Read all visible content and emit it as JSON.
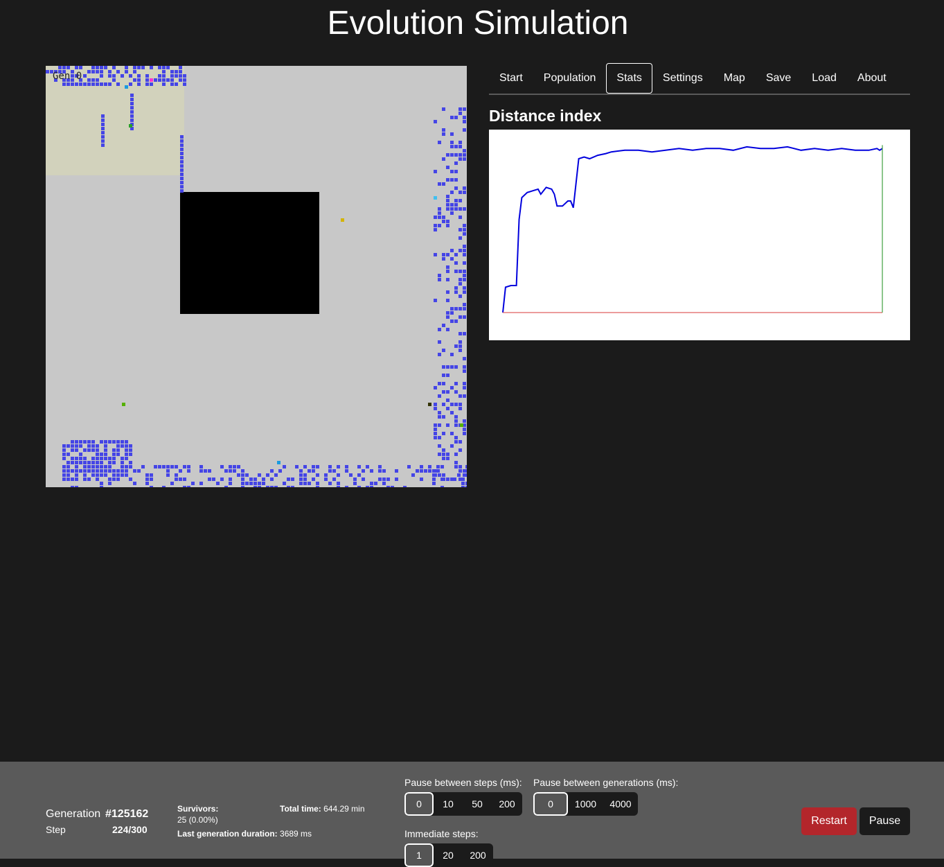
{
  "app": {
    "title": "Evolution Simulation"
  },
  "world": {
    "overlay_text": "Gen  0",
    "colors": {
      "background": "#c8c8c8",
      "barrier": "#000000",
      "safe_zone": "#d2d2bc",
      "creature": "#4545e6"
    }
  },
  "tabs": [
    {
      "label": "Start"
    },
    {
      "label": "Population"
    },
    {
      "label": "Stats",
      "active": true
    },
    {
      "label": "Settings"
    },
    {
      "label": "Map"
    },
    {
      "label": "Save"
    },
    {
      "label": "Load"
    },
    {
      "label": "About"
    }
  ],
  "stats": {
    "heading": "Distance index"
  },
  "chart_data": {
    "type": "line",
    "title": "Distance index",
    "xlabel": "",
    "ylabel": "",
    "ylim": [
      0,
      1
    ],
    "grid": false,
    "series": [
      {
        "color": "#0000dd",
        "points": [
          [
            0,
            0.0
          ],
          [
            1,
            0.15
          ],
          [
            3,
            0.16
          ],
          [
            5,
            0.16
          ],
          [
            6,
            0.55
          ],
          [
            7,
            0.68
          ],
          [
            9,
            0.71
          ],
          [
            11,
            0.72
          ],
          [
            13,
            0.73
          ],
          [
            14,
            0.7
          ],
          [
            16,
            0.74
          ],
          [
            18,
            0.73
          ],
          [
            19,
            0.7
          ],
          [
            20,
            0.63
          ],
          [
            22,
            0.63
          ],
          [
            24,
            0.66
          ],
          [
            25,
            0.66
          ],
          [
            26,
            0.62
          ],
          [
            28,
            0.91
          ],
          [
            30,
            0.92
          ],
          [
            32,
            0.91
          ],
          [
            35,
            0.93
          ],
          [
            38,
            0.94
          ],
          [
            40,
            0.95
          ],
          [
            45,
            0.96
          ],
          [
            50,
            0.96
          ],
          [
            55,
            0.95
          ],
          [
            60,
            0.96
          ],
          [
            65,
            0.97
          ],
          [
            70,
            0.96
          ],
          [
            75,
            0.97
          ],
          [
            80,
            0.97
          ],
          [
            85,
            0.96
          ],
          [
            90,
            0.98
          ],
          [
            95,
            0.97
          ],
          [
            100,
            0.97
          ],
          [
            105,
            0.98
          ],
          [
            110,
            0.96
          ],
          [
            115,
            0.97
          ],
          [
            120,
            0.96
          ],
          [
            125,
            0.97
          ],
          [
            130,
            0.96
          ],
          [
            135,
            0.96
          ],
          [
            138,
            0.97
          ],
          [
            139,
            0.96
          ],
          [
            140,
            0.97
          ]
        ]
      },
      {
        "color": "#e06060",
        "points": [
          [
            0,
            0
          ],
          [
            140,
            0
          ]
        ]
      },
      {
        "color": "#40a040",
        "points": [
          [
            140,
            0
          ],
          [
            140,
            0.99
          ]
        ]
      }
    ],
    "xlim": [
      0,
      140
    ]
  },
  "footer": {
    "generation_label": "Generation",
    "generation_value": "#125162",
    "step_label": "Step",
    "step_value": "224/300",
    "survivors_label": "Survivors:",
    "survivors_value": "25 (0.00%)",
    "total_time_label": "Total time:",
    "total_time_value": "644.29 min",
    "last_gen_label": "Last generation duration:",
    "last_gen_value": "3689 ms",
    "pause_steps": {
      "label": "Pause between steps (ms):",
      "options": [
        "0",
        "10",
        "50",
        "200"
      ],
      "selected": "0"
    },
    "pause_generations": {
      "label": "Pause between generations (ms):",
      "options": [
        "0",
        "1000",
        "4000"
      ],
      "selected": "0"
    },
    "immediate_steps": {
      "label": "Immediate steps:",
      "options": [
        "1",
        "20",
        "200"
      ],
      "selected": "1"
    },
    "restart_label": "Restart",
    "pause_label": "Pause",
    "restart_color": "#b3262b"
  }
}
